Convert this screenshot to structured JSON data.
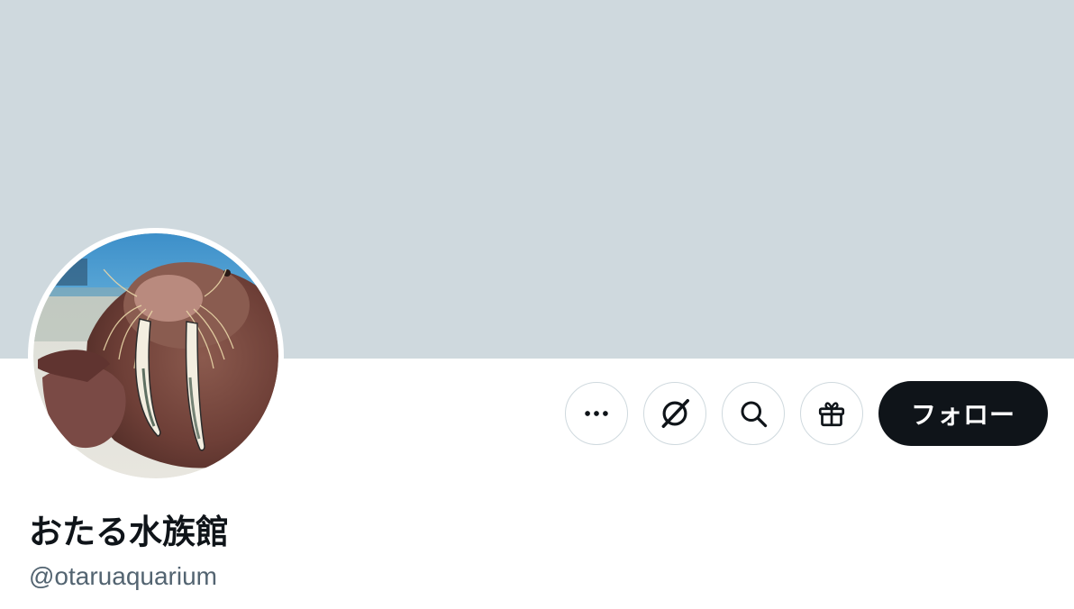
{
  "profile": {
    "display_name": "おたる水族館",
    "handle": "@otaruaquarium",
    "avatar_description": "walrus-photo"
  },
  "actions": {
    "more_icon": "ellipsis-icon",
    "grok_icon": "grok-icon",
    "search_icon": "search-icon",
    "gift_icon": "gift-icon",
    "follow_label": "フォロー"
  },
  "colors": {
    "banner": "#cfd9de",
    "primary_text": "#0f1419",
    "secondary_text": "#536471",
    "button_border": "#cfd9de",
    "follow_bg": "#0f1419"
  }
}
